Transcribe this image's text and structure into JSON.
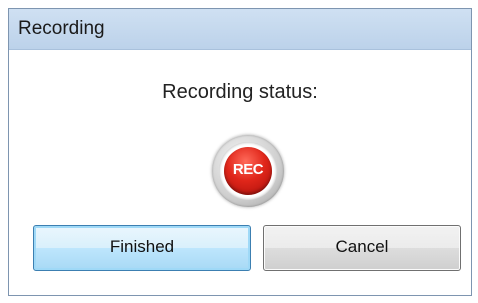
{
  "window": {
    "title": "Recording"
  },
  "status": {
    "label": "Recording status:",
    "indicator_text": "REC",
    "indicator_icon": "record-icon"
  },
  "buttons": {
    "finished_label": "Finished",
    "cancel_label": "Cancel"
  },
  "colors": {
    "titlebar": "#c4d8ee",
    "rec_red": "#e0261a",
    "default_button_border": "#3c7fb1"
  }
}
